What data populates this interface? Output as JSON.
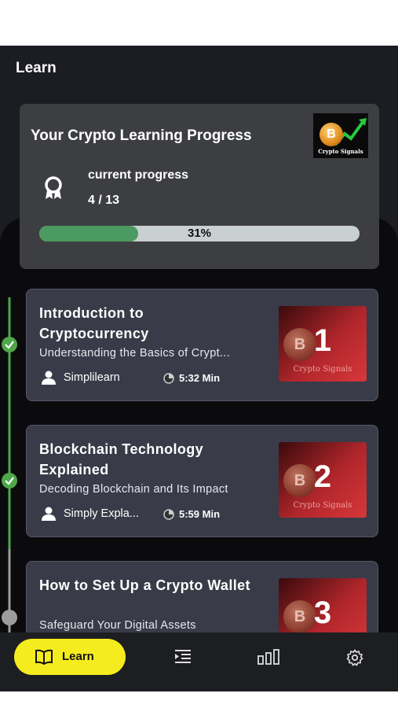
{
  "header": {
    "title": "Learn"
  },
  "progress": {
    "title": "Your Crypto Learning Progress",
    "thumbnail_caption": "Crypto Signals",
    "thumbnail_letter": "B",
    "label": "current progress",
    "count": "4 / 13",
    "percent_text": "31%",
    "fraction": 0.31
  },
  "courses": [
    {
      "title": "Introduction to Cryptocurrency",
      "subtitle": "Understanding the Basics of Crypt...",
      "author": "Simplilearn",
      "duration": "5:32 Min",
      "number": "1",
      "thumb_caption": "Crypto Signals",
      "thumb_letter": "B",
      "completed": true
    },
    {
      "title": "Blockchain Technology Explained",
      "subtitle": "Decoding Blockchain and Its Impact",
      "author": "Simply Expla...",
      "duration": "5:59 Min",
      "number": "2",
      "thumb_caption": "Crypto Signals",
      "thumb_letter": "B",
      "completed": true
    },
    {
      "title": "How to Set Up a Crypto Wallet",
      "subtitle": "Safeguard Your Digital Assets",
      "number": "3",
      "thumb_letter": "B",
      "completed": false
    }
  ],
  "nav": {
    "learn_label": "Learn",
    "icons": [
      "book-icon",
      "list-indent-icon",
      "bar-chart-icon",
      "gear-icon"
    ]
  },
  "colors": {
    "accent_yellow": "#f5ec1f",
    "progress_green": "#4a9a61",
    "check_green": "#4fa74a",
    "card_bg": "#3a3b48"
  }
}
